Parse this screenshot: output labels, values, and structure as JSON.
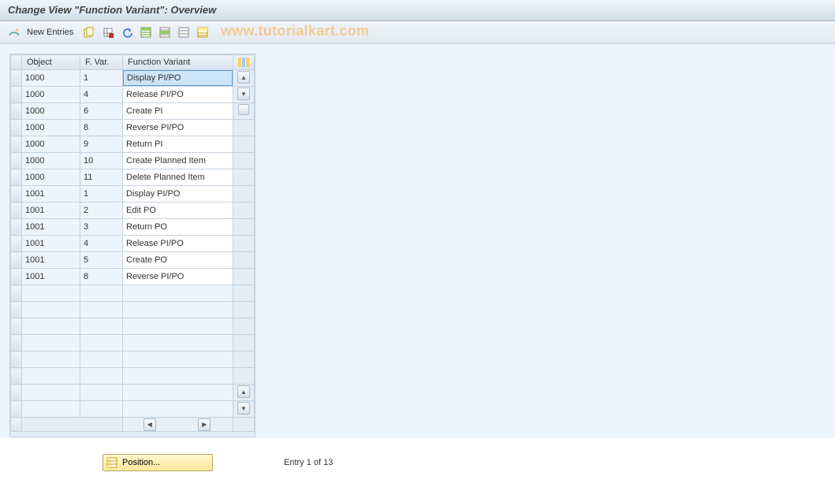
{
  "title": "Change View \"Function Variant\": Overview",
  "watermark": "www.tutorialkart.com",
  "toolbar": {
    "new_entries_label": "New Entries"
  },
  "table": {
    "columns": {
      "object": "Object",
      "fvar": "F. Var.",
      "function_variant": "Function Variant"
    },
    "rows": [
      {
        "object": "1000",
        "fvar": "1",
        "fn": "Display PI/PO",
        "selected": true
      },
      {
        "object": "1000",
        "fvar": "4",
        "fn": "Release PI/PO"
      },
      {
        "object": "1000",
        "fvar": "6",
        "fn": "Create PI"
      },
      {
        "object": "1000",
        "fvar": "8",
        "fn": "Reverse PI/PO"
      },
      {
        "object": "1000",
        "fvar": "9",
        "fn": "Return PI"
      },
      {
        "object": "1000",
        "fvar": "10",
        "fn": "Create Planned Item"
      },
      {
        "object": "1000",
        "fvar": "11",
        "fn": "Delete Planned Item"
      },
      {
        "object": "1001",
        "fvar": "1",
        "fn": "Display PI/PO"
      },
      {
        "object": "1001",
        "fvar": "2",
        "fn": "Edit PO"
      },
      {
        "object": "1001",
        "fvar": "3",
        "fn": "Return PO"
      },
      {
        "object": "1001",
        "fvar": "4",
        "fn": "Release PI/PO"
      },
      {
        "object": "1001",
        "fvar": "5",
        "fn": "Create PO"
      },
      {
        "object": "1001",
        "fvar": "8",
        "fn": "Reverse PI/PO"
      }
    ],
    "empty_rows": 8
  },
  "footer": {
    "position_label": "Position...",
    "entry_text": "Entry 1 of 13"
  }
}
